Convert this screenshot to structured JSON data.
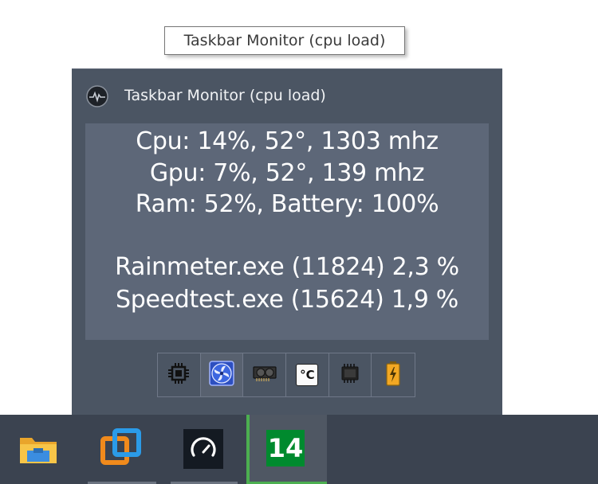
{
  "tooltip": {
    "text": "Taskbar Monitor (cpu load)"
  },
  "popup": {
    "title": "Taskbar Monitor (cpu load)",
    "lines": [
      "Cpu: 14%, 52°, 1303 mhz",
      "Gpu: 7%, 52°, 139 mhz",
      "Ram: 52%, Battery: 100%",
      "Rainmeter.exe (11824) 2,3 %",
      "Speedtest.exe (15624) 1,9 %"
    ],
    "icon_buttons": [
      {
        "icon": "cpu-chip-icon"
      },
      {
        "icon": "fan-icon"
      },
      {
        "icon": "gpu-card-icon"
      },
      {
        "icon": "temperature-celsius-icon",
        "label": "°C"
      },
      {
        "icon": "ram-chip-icon"
      },
      {
        "icon": "battery-icon"
      }
    ]
  },
  "taskbar": {
    "items": [
      {
        "icon": "file-explorer-icon"
      },
      {
        "icon": "virtual-desktop-app-icon"
      },
      {
        "icon": "speedtest-gauge-icon"
      },
      {
        "icon": "taskbar-monitor-icon",
        "value": "14"
      }
    ]
  },
  "colors": {
    "popup_bg": "#4b5563",
    "preview_bg": "#5d6778",
    "taskbar_bg": "#3b4350",
    "monitor_green": "#008a2e",
    "active_underline": "#4caf50"
  }
}
